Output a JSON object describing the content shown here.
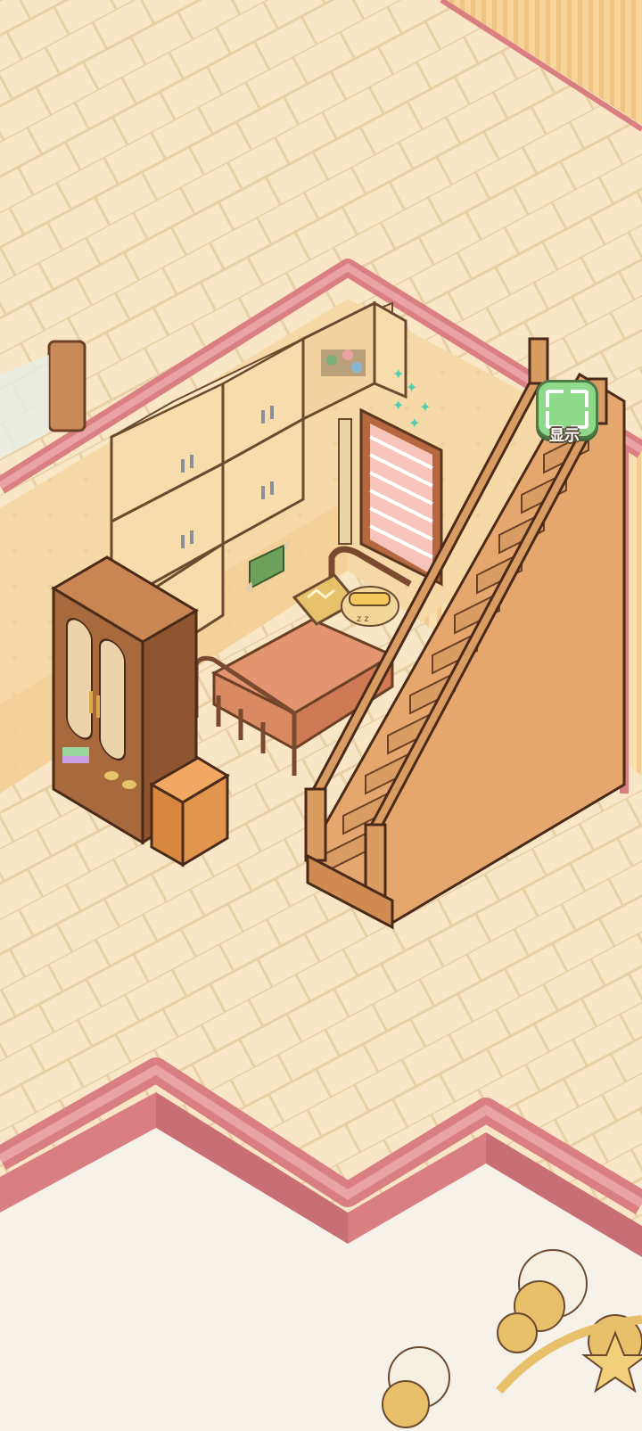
{
  "hud": {
    "show_button": {
      "label": "显示",
      "icon": "expand-frame-icon"
    }
  },
  "colors": {
    "floor": "#f8e6c6",
    "floor_plank_line": "#e9cfa5",
    "wall": "#f6d9a6",
    "wall_trim": "#d97f82",
    "wood_dark": "#a86a3d",
    "wood_light": "#d99c62",
    "button_green": "#8fd98a"
  }
}
